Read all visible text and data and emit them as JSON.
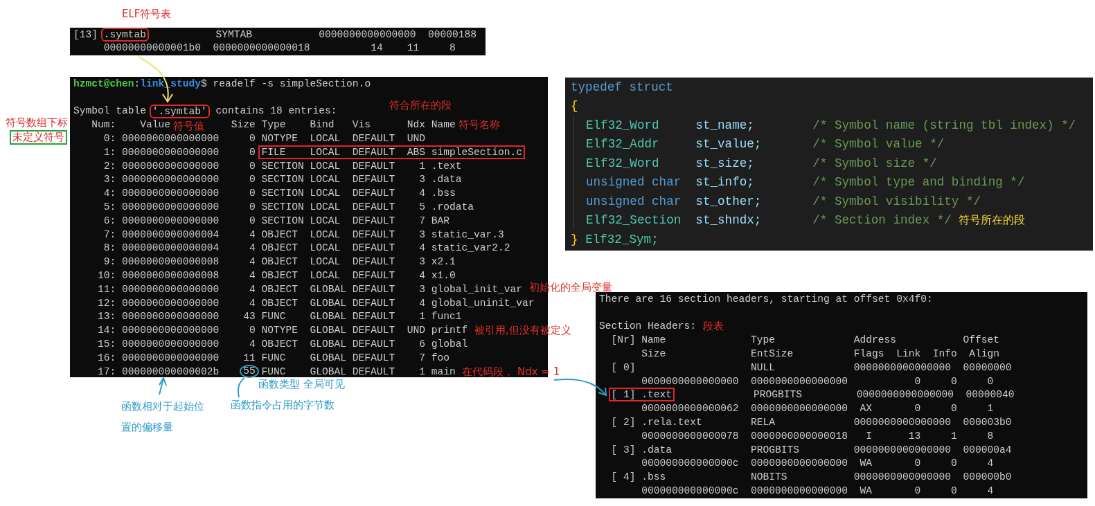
{
  "elf_symtab_label": "ELF符号表",
  "section_entry": {
    "index": "[13]",
    "name": ".symtab",
    "rest": "SYMTAB           0000000000000000  00000188",
    "line2": "     00000000000001b0  0000000000000018          14    11     8"
  },
  "symbol_terminal": {
    "user_host": "hzmct@chen",
    "separator": ":",
    "path": "link_study",
    "command": "$ readelf -s simpleSection.o",
    "title": {
      "prefix": "Symbol table",
      "name": "'.symtab'",
      "suffix": "contains 18 entries:",
      "note": "符合所在的段"
    },
    "header": {
      "left": "   Num:    Value",
      "value_note": "符号值",
      "right": "Size Type    Bind   Vis      Ndx Name",
      "name_note": "符号名称"
    },
    "rows": [
      {
        "text": "     0: 0000000000000000     0 NOTYPE  LOCAL  DEFAULT  UND"
      },
      {
        "text": "     1: 0000000000000000     0",
        "marked": "FILE    LOCAL  DEFAULT  ABS simpleSection.c"
      },
      {
        "text": "     2: 0000000000000000     0 SECTION LOCAL  DEFAULT    1 .text"
      },
      {
        "text": "     3: 0000000000000000     0 SECTION LOCAL  DEFAULT    3 .data"
      },
      {
        "text": "     4: 0000000000000000     0 SECTION LOCAL  DEFAULT    4 .bss"
      },
      {
        "text": "     5: 0000000000000000     0 SECTION LOCAL  DEFAULT    5 .rodata"
      },
      {
        "text": "     6: 0000000000000000     0 SECTION LOCAL  DEFAULT    7 BAR"
      },
      {
        "text": "     7: 0000000000000004     4 OBJECT  LOCAL  DEFAULT    3 static_var.3"
      },
      {
        "text": "     8: 0000000000000004     4 OBJECT  LOCAL  DEFAULT    4 static_var2.2"
      },
      {
        "text": "     9: 0000000000000008     4 OBJECT  LOCAL  DEFAULT    3 x2.1"
      },
      {
        "text": "    10: 0000000000000008     4 OBJECT  LOCAL  DEFAULT    4 x1.0"
      },
      {
        "text": "    11: 0000000000000000     4 OBJECT  GLOBAL DEFAULT    3 global_init_var",
        "note": "初始化的全局变量"
      },
      {
        "text": "    12: 0000000000000000     4 OBJECT  GLOBAL DEFAULT    4 global_uninit_var"
      },
      {
        "text": "    13: 0000000000000000    43 FUNC    GLOBAL DEFAULT    1 func1"
      },
      {
        "text": "    14: 0000000000000000     0 NOTYPE  GLOBAL DEFAULT  UND printf",
        "note": "被引用,但没有被定义"
      },
      {
        "text": "    15: 0000000000000000     4 OBJECT  GLOBAL DEFAULT    6 global"
      },
      {
        "text": "    16: 0000000000000000    11 FUNC    GLOBAL DEFAULT    7 foo"
      },
      {
        "text": "    17: 000000000000002b",
        "circled": "55",
        "after": "FUNC    GLOBAL DEFAULT    1 main",
        "note": "在代码段， Ndx = 1"
      }
    ]
  },
  "annotations": {
    "index_note": "符号数组下标",
    "undefined_note": "未定义符号",
    "type_note": "函数类型  全局可见",
    "offset_note": "函数相对于起始位置的偏移量",
    "size_note": "函数指令占用的字节数"
  },
  "struct_code": {
    "opening": "typedef struct",
    "open_brace": "{",
    "members": [
      {
        "type": "Elf32_Word",
        "kind": "typedef",
        "field": "st_name;",
        "comment": "/* Symbol name (string tbl index) */"
      },
      {
        "type": "Elf32_Addr",
        "kind": "typedef",
        "field": "st_value;",
        "comment": "/* Symbol value */"
      },
      {
        "type": "Elf32_Word",
        "kind": "typedef",
        "field": "st_size;",
        "comment": "/* Symbol size */"
      },
      {
        "type": "unsigned char",
        "kind": "keyword",
        "field": "st_info;",
        "comment": "/* Symbol type and binding */"
      },
      {
        "type": "unsigned char",
        "kind": "keyword",
        "field": "st_other;",
        "comment": "/* Symbol visibility */"
      },
      {
        "type": "Elf32_Section",
        "kind": "typedef",
        "field": "st_shndx;",
        "comment": "/* Section index */",
        "note": "符号所在的段"
      }
    ],
    "close_brace": "}",
    "name": "Elf32_Sym;"
  },
  "section_terminal": {
    "intro": "There are 16 section headers, starting at offset 0x4f0:",
    "headers_title": "Section Headers:",
    "headers_note": "段表",
    "lines": [
      {
        "text": "  [Nr] Name              Type             Address           Offset"
      },
      {
        "text": "       Size              EntSize          Flags  Link  Info  Align"
      },
      {
        "text": "  [ 0]                   NULL             0000000000000000  00000000"
      },
      {
        "text": "       0000000000000000  0000000000000000           0     0     0"
      },
      {
        "marked": "[ 1] .text",
        "after": "PROGBITS         0000000000000000  00000040"
      },
      {
        "text": "       0000000000000062  0000000000000000  AX       0     0     1"
      },
      {
        "text": "  [ 2] .rela.text        RELA             0000000000000000  000003b0"
      },
      {
        "text": "       0000000000000078  0000000000000018   I      13     1     8"
      },
      {
        "text": "  [ 3] .data             PROGBITS         0000000000000000  000000a4"
      },
      {
        "text": "       000000000000000c  0000000000000000  WA       0     0     4"
      },
      {
        "text": "  [ 4] .bss              NOBITS           0000000000000000  000000b0"
      },
      {
        "text": "       000000000000000c  0000000000000000  WA       0     0     4"
      }
    ]
  }
}
